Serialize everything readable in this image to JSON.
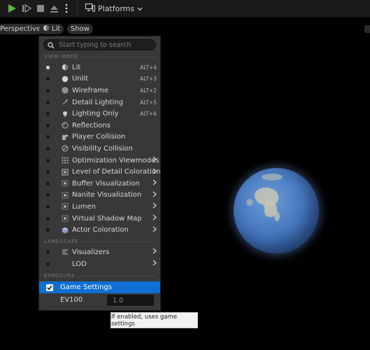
{
  "toolbar": {
    "platforms_label": "Platforms"
  },
  "viewport_bar": {
    "perspective_label": "Perspective",
    "lit_label": "Lit",
    "show_label": "Show"
  },
  "menu": {
    "search_placeholder": "Start typing to search",
    "sections": {
      "view_mode": "VIEW MODE",
      "landscape": "LANDSCAPE",
      "exposure": "EXPOSURE"
    },
    "view_modes": [
      {
        "label": "Lit",
        "shortcut": "ALT+4",
        "icon": "lit-sphere-icon",
        "selected": true
      },
      {
        "label": "Unlit",
        "shortcut": "ALT+3",
        "icon": "unlit-sphere-icon",
        "selected": false
      },
      {
        "label": "Wireframe",
        "shortcut": "ALT+2",
        "icon": "wireframe-sphere-icon",
        "selected": false
      },
      {
        "label": "Detail Lighting",
        "shortcut": "ALT+5",
        "icon": "detail-lighting-icon",
        "selected": false
      },
      {
        "label": "Lighting Only",
        "shortcut": "ALT+6",
        "icon": "bulb-icon",
        "selected": false
      },
      {
        "label": "Reflections",
        "shortcut": "",
        "icon": "reflections-icon",
        "selected": false
      },
      {
        "label": "Player Collision",
        "shortcut": "",
        "icon": "player-collision-icon",
        "selected": false
      },
      {
        "label": "Visibility Collision",
        "shortcut": "",
        "icon": "visibility-collision-icon",
        "selected": false
      },
      {
        "label": "Optimization Viewmodes",
        "shortcut": "",
        "icon": "grid-icon",
        "selected": false,
        "submenu": true
      },
      {
        "label": "Level of Detail Coloration",
        "shortcut": "",
        "icon": "lod-icon",
        "selected": false,
        "submenu": true
      },
      {
        "label": "Buffer Visualization",
        "shortcut": "",
        "icon": "buffer-icon",
        "selected": false,
        "submenu": true
      },
      {
        "label": "Nanite Visualization",
        "shortcut": "",
        "icon": "nanite-icon",
        "selected": false,
        "submenu": true
      },
      {
        "label": "Lumen",
        "shortcut": "",
        "icon": "lumen-icon",
        "selected": false,
        "submenu": true
      },
      {
        "label": "Virtual Shadow Map",
        "shortcut": "",
        "icon": "shadow-map-icon",
        "selected": false,
        "submenu": true
      },
      {
        "label": "Actor Coloration",
        "shortcut": "",
        "icon": "actor-cube-icon",
        "selected": false,
        "submenu": true
      }
    ],
    "landscape_items": [
      {
        "label": "Visualizers",
        "icon": "visualizers-icon",
        "submenu": true
      },
      {
        "label": "LOD",
        "icon": "",
        "submenu": true
      }
    ],
    "exposure": {
      "game_settings_label": "Game Settings",
      "game_settings_checked": true,
      "ev100_label": "EV100",
      "ev100_value": "1.0"
    }
  },
  "tooltip": {
    "text": "If enabled, uses game settings"
  },
  "colors": {
    "highlight": "#0f6ed1",
    "play_green": "#59b740",
    "menu_bg": "#383838"
  }
}
